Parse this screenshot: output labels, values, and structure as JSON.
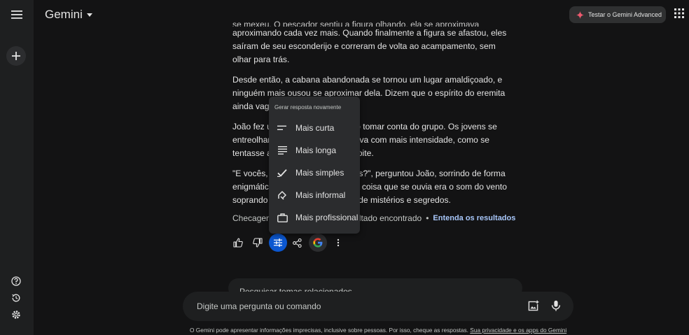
{
  "header": {
    "brand": "Gemini",
    "upgrade_label": "Testar o Gemini Advanced"
  },
  "sidebar": {
    "icons": [
      "menu-icon",
      "plus-icon",
      "help-icon",
      "history-icon",
      "settings-icon"
    ]
  },
  "response": {
    "paragraph_1_cut": "se mexeu. O pescador sentiu a figura olhando, ela se aproximava",
    "paragraph_1": "aproximando cada vez mais. Quando finalmente a figura se afastou, eles saíram de seu esconderijo e correram de volta ao acampamento, sem olhar para trás.",
    "paragraph_2": "Desde então, a cabana abandonada se tornou um lugar amaldiçoado, e ninguém mais ousou se aproximar dela. Dizem que o espírito do eremita ainda vaga pela floresta, à",
    "paragraph_3": "João fez uma pausa e um silêncio tomar conta do grupo. Os jovens se entreolharam, e a fogueira crepitava com mais intensidade, como se tentasse afastar a escuridão da noite.",
    "paragraph_4": "\"E vocês, acreditam em fantasmas?\", perguntou João, sorrindo de forma enigmática. O silêncio era a única coisa que se ouvia era o som do vento soprando entre as árvores, cheio de mistérios e segredos."
  },
  "fact_check": {
    "label": "Checagem de fatos: nenhum resultado encontrado",
    "separator": "•",
    "link": "Entenda os resultados"
  },
  "actions": [
    "thumb-up-icon",
    "thumb-down-icon",
    "tune-icon",
    "share-icon",
    "google-icon",
    "more-icon"
  ],
  "modify_menu": {
    "title": "Gerar resposta novamente",
    "items": [
      {
        "label": "Mais curta",
        "icon": "short-text-icon"
      },
      {
        "label": "Mais longa",
        "icon": "long-text-icon"
      },
      {
        "label": "Mais simples",
        "icon": "check-icon"
      },
      {
        "label": "Mais informal",
        "icon": "casual-icon"
      },
      {
        "label": "Mais profissional",
        "icon": "briefcase-icon"
      }
    ]
  },
  "related": {
    "label": "Pesquisar temas relacionados"
  },
  "prompt": {
    "placeholder": "Digite uma pergunta ou comando"
  },
  "footer": {
    "disclaimer": "O Gemini pode apresentar informações imprecisas, inclusive sobre pessoas. Por isso, cheque as respostas.",
    "privacy_link": "Sua privacidade e os apps do Gemini"
  },
  "colors": {
    "background": "#131314",
    "sidebar": "#1e1f20",
    "accent": "#0b57d0",
    "link": "#a8c7fa"
  }
}
